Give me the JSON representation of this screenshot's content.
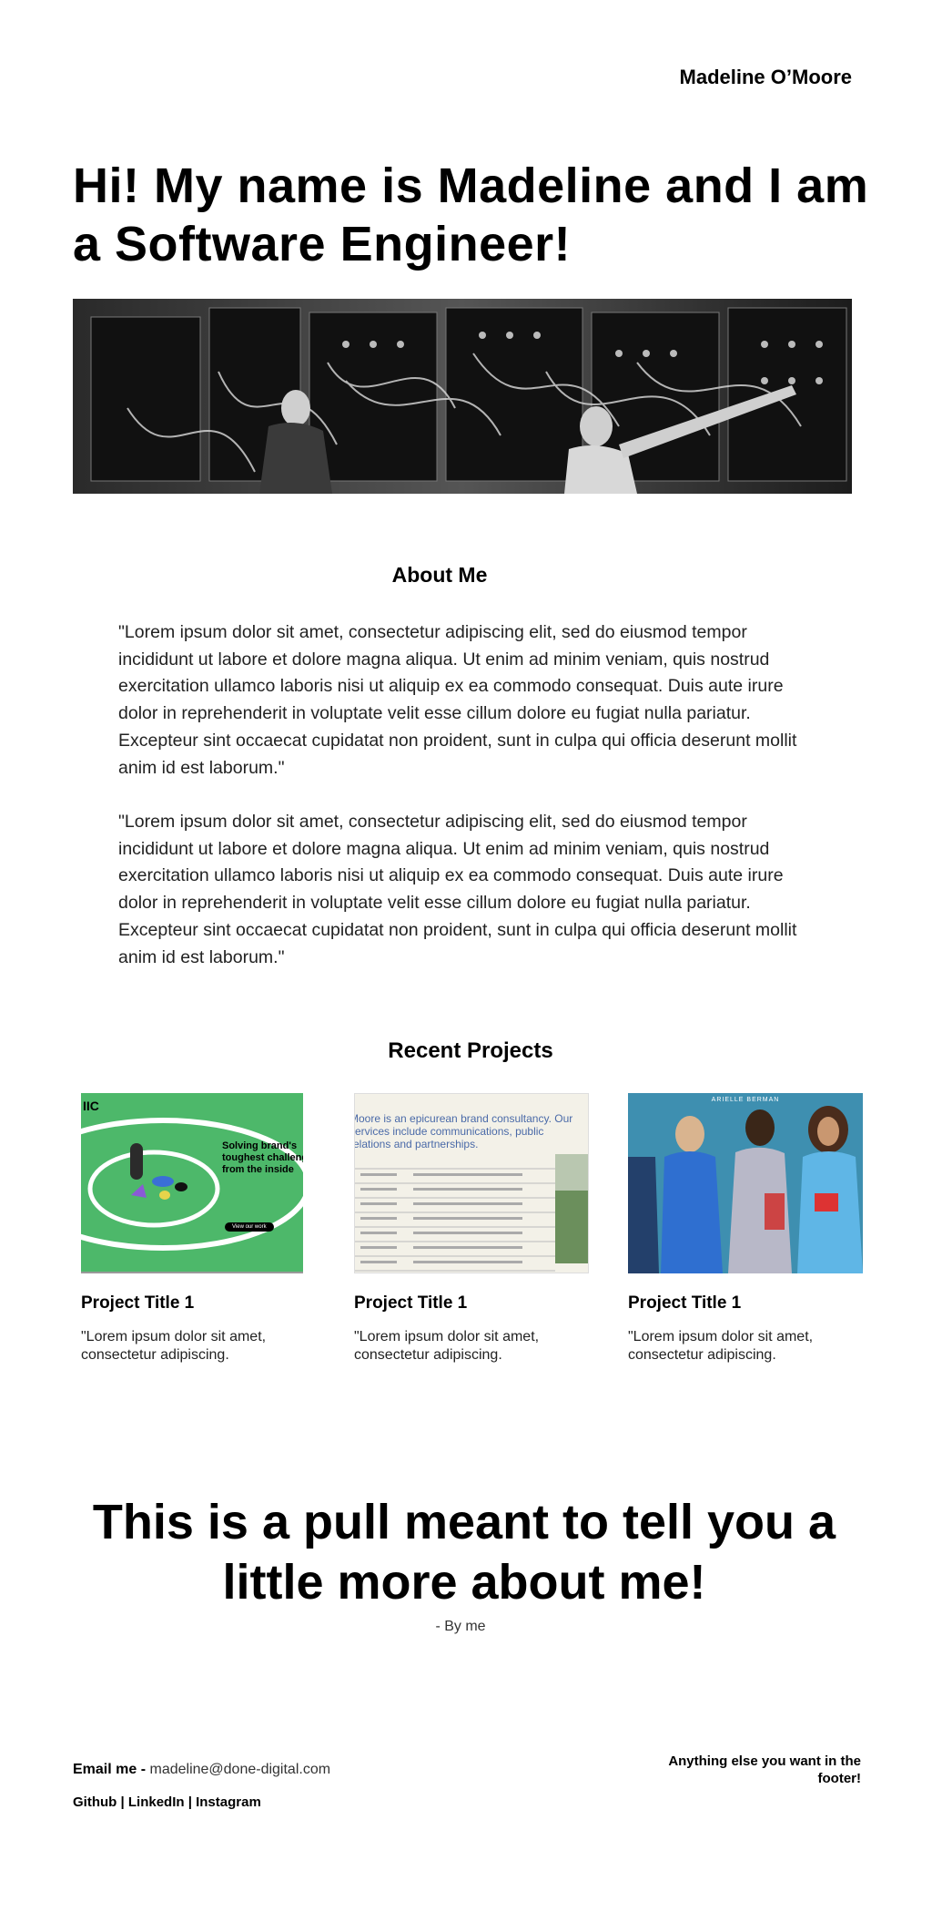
{
  "header": {
    "brand": "Madeline O’Moore"
  },
  "hero": {
    "title": "Hi! My name is Madeline and I am a Software Engineer!"
  },
  "about": {
    "title": "About Me",
    "paragraphs": [
      "\"Lorem ipsum dolor sit amet, consectetur adipiscing elit, sed do eiusmod tempor incididunt ut labore et dolore magna aliqua. Ut enim ad minim veniam, quis nostrud exercitation ullamco laboris nisi ut aliquip ex ea commodo consequat. Duis aute irure dolor in reprehenderit in voluptate velit esse cillum dolore eu fugiat nulla pariatur. Excepteur sint occaecat cupidatat non proident, sunt in culpa qui officia deserunt mollit anim id est laborum.\"",
      "\"Lorem ipsum dolor sit amet, consectetur adipiscing elit, sed do eiusmod tempor incididunt ut labore et dolore magna aliqua. Ut enim ad minim veniam, quis nostrud exercitation ullamco laboris nisi ut aliquip ex ea commodo consequat. Duis aute irure dolor in reprehenderit in voluptate velit esse cillum dolore eu fugiat nulla pariatur. Excepteur sint occaecat cupidatat non proident, sunt in culpa qui officia deserunt mollit anim id est laborum.\""
    ]
  },
  "projects": {
    "title": "Recent Projects",
    "items": [
      {
        "title": "Project Title 1",
        "desc": "\"Lorem ipsum dolor sit amet, consectetur adipiscing.",
        "thumb": {
          "logo": "IIC",
          "heading": "Solving brand's toughest challenges from the inside",
          "cta": "View our work",
          "bg": "#4db86a"
        }
      },
      {
        "title": "Project Title 1",
        "desc": "\"Lorem ipsum dolor sit amet, consectetur adipiscing.",
        "thumb": {
          "heading": "Moore is an epicurean brand consultancy. Our services include communications, public relations and partnerships.",
          "bg": "#f3f1e8",
          "accent": "#4a6aa8"
        }
      },
      {
        "title": "Project Title 1",
        "desc": "\"Lorem ipsum dolor sit amet, consectetur adipiscing.",
        "thumb": {
          "label": "ARIELLE BERMAN",
          "bg": "#3e8fb0"
        }
      }
    ]
  },
  "pull": {
    "quote": "This is a pull meant to tell you a little more about me!",
    "byline": "- By me"
  },
  "footer": {
    "email_label": "Email me -",
    "email": "madeline@done-digital.com",
    "links": [
      "Github",
      "LinkedIn",
      "Instagram"
    ],
    "separator": "|",
    "right_note": "Anything else you want in the footer!"
  }
}
